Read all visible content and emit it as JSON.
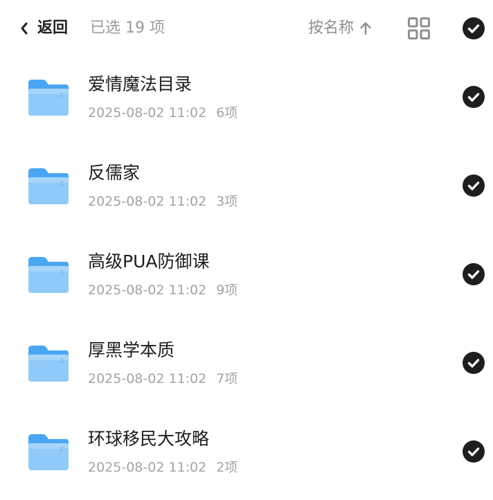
{
  "header": {
    "back_label": "返回",
    "selected_text": "已选 19 项",
    "sort_label": "按名称",
    "icons": {
      "back": "chevron-left-icon",
      "sort_direction": "arrow-up-icon",
      "view_toggle": "grid-view-icon",
      "select_all": "check-circle-icon"
    },
    "select_all_checked": true
  },
  "colors": {
    "check_fill": "#1e1e1e",
    "folder_back": "#4aa6f2",
    "folder_front": "#8fcaf8",
    "secondary_text": "#a3a3a3"
  },
  "files": [
    {
      "name": "爱情魔法目录",
      "date": "2025-08-02 11:02",
      "count": "6项",
      "checked": true,
      "icon": "folder-icon"
    },
    {
      "name": "反儒家",
      "date": "2025-08-02 11:02",
      "count": "3项",
      "checked": true,
      "icon": "folder-icon"
    },
    {
      "name": "高级PUA防御课",
      "date": "2025-08-02 11:02",
      "count": "9项",
      "checked": true,
      "icon": "folder-icon"
    },
    {
      "name": "厚黑学本质",
      "date": "2025-08-02 11:02",
      "count": "7项",
      "checked": true,
      "icon": "folder-icon"
    },
    {
      "name": "环球移民大攻略",
      "date": "2025-08-02 11:02",
      "count": "2项",
      "checked": true,
      "icon": "folder-icon"
    }
  ]
}
